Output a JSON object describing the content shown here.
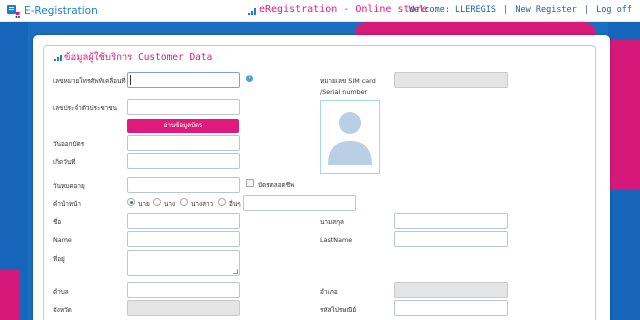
{
  "header": {
    "logo_text": "E-Registration",
    "title": "eRegistration - Online store",
    "welcome": "Welcome: LLEREGIS",
    "new_register": "New Register",
    "logoff": "Log off",
    "separator": "|"
  },
  "section": {
    "title": "ข้อมูลผู้ใช้บริการ Customer Data"
  },
  "form": {
    "phone_label": "เลขหมายโทรศัพท์เคลื่อนที่",
    "sim_label_1": "หมายเลข SIM card",
    "sim_label_2": "/Serial number",
    "id_label": "เลขประจำตัวประชาชน",
    "read_card_button": "อ่านข้อมูลบัตร",
    "issue_date_label": "วันออกบัตร",
    "birth_date_label": "เกิดวันที่",
    "expiry_label": "วันหมดอายุ",
    "lifetime_card_label": "บัตรตลอดชีพ",
    "title_prefix_label": "คำนำหน้า",
    "title_options": [
      "นาย",
      "นาง",
      "นางสาว",
      "อื่นๆ"
    ],
    "title_selected": "นาย",
    "firstname_th_label": "ชื่อ",
    "lastname_th_label": "นามสกุล",
    "name_en_label": "Name",
    "lastname_en_label": "LastName",
    "address_label": "ที่อยู่",
    "subdistrict_label": "ตำบล",
    "district_label": "อำเภอ",
    "province_label": "จังหวัด",
    "postcode_label": "รหัสไปรษณีย์"
  },
  "colors": {
    "accent": "#e0197d",
    "brand_blue": "#1f7fc8",
    "background": "#1b6fc0"
  },
  "icons": {
    "help": "?"
  }
}
